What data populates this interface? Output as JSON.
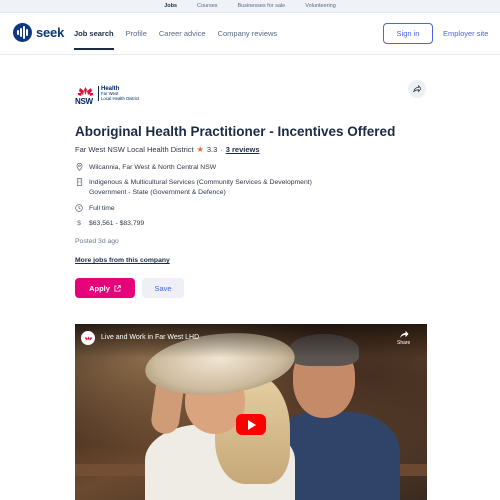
{
  "top_strip": [
    "Jobs",
    "Courses",
    "Businesses for sale",
    "Volunteering"
  ],
  "header": {
    "logo_text": "seek",
    "nav": [
      "Job search",
      "Profile",
      "Career advice",
      "Company reviews"
    ],
    "sign_in": "Sign in",
    "employer_site": "Employer site"
  },
  "company_logo": {
    "nsw": "NSW",
    "health": "Health",
    "district_line1": "Far West",
    "district_line2": "Local Health District"
  },
  "job": {
    "title": "Aboriginal Health Practitioner - Incentives Offered",
    "company": "Far West NSW Local Health District",
    "rating": "3.3",
    "separator": "·",
    "reviews": "3 reviews",
    "location": "Wilcannia, Far West & North Central NSW",
    "category_line1": "Indigenous & Multicultural Services (Community Services & Development)",
    "category_line2": "Government - State (Government & Defence)",
    "work_type": "Full time",
    "salary": "$63,561 - $83,799",
    "posted": "Posted 3d ago",
    "more_jobs": "More jobs from this company",
    "apply": "Apply",
    "save": "Save"
  },
  "video": {
    "title": "Live and Work in Far West LHD",
    "share": "Share"
  },
  "colors": {
    "brand_blue": "#0d3880",
    "link_blue": "#4964e9",
    "apply_pink": "#e60278",
    "star": "#e8622d"
  }
}
